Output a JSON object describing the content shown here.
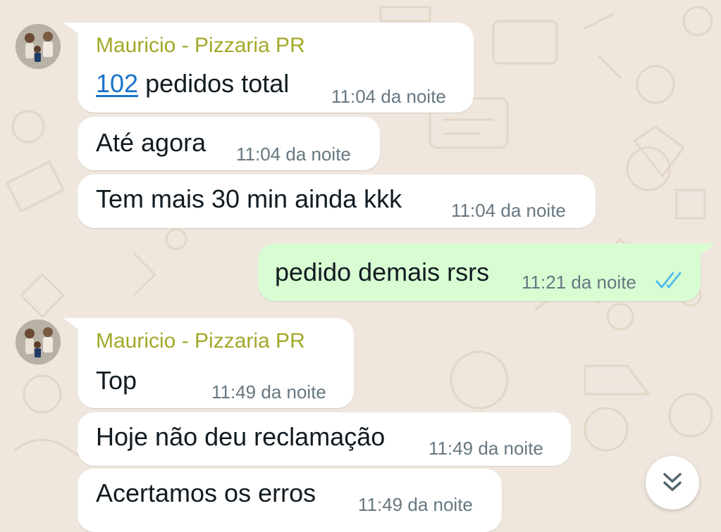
{
  "chat": {
    "messages": [
      {
        "direction": "incoming",
        "sender": "Mauricio - Pizzaria PR",
        "link_number": "102",
        "text": " pedidos total",
        "time": "11:04 da noite"
      },
      {
        "direction": "incoming",
        "text": "Até agora",
        "time": "11:04 da noite"
      },
      {
        "direction": "incoming",
        "text": "Tem mais 30 min ainda kkk",
        "time": "11:04 da noite"
      },
      {
        "direction": "outgoing",
        "text": "pedido demais rsrs",
        "time": "11:21 da noite",
        "status": "read",
        "status_icon": "double-check-icon",
        "status_color": "#53bdeb"
      },
      {
        "direction": "incoming",
        "sender": "Mauricio - Pizzaria PR",
        "text": "Top",
        "time": "11:49 da noite"
      },
      {
        "direction": "incoming",
        "text": "Hoje não deu reclamação",
        "time": "11:49 da noite"
      },
      {
        "direction": "incoming",
        "text": "Acertamos os erros",
        "time": "11:49 da noite"
      }
    ],
    "scroll_button_icon": "double-chevron-down-icon"
  },
  "colors": {
    "background": "#efe7de",
    "incoming_bubble": "#ffffff",
    "outgoing_bubble": "#d9fdd3",
    "sender_name": "#a3a829",
    "link": "#1a73c9",
    "timestamp": "#667781",
    "read_ticks": "#53bdeb"
  }
}
